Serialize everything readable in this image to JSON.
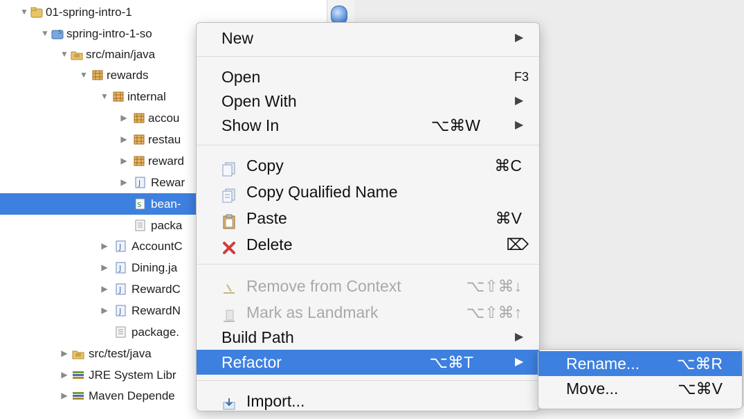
{
  "tree": {
    "rows": [
      {
        "label": "01-spring-intro-1",
        "icon": "project-icon"
      },
      {
        "label": "spring-intro-1-so",
        "icon": "spring-project-icon"
      },
      {
        "label": "src/main/java",
        "icon": "source-folder-icon"
      },
      {
        "label": "rewards",
        "icon": "package-icon"
      },
      {
        "label": "internal",
        "icon": "package-icon"
      },
      {
        "label": "accou",
        "icon": "package-icon"
      },
      {
        "label": "restau",
        "icon": "package-icon"
      },
      {
        "label": "reward",
        "icon": "package-icon"
      },
      {
        "label": "Rewar",
        "icon": "java-file-icon"
      },
      {
        "label": "bean-",
        "icon": "spring-bean-file-icon"
      },
      {
        "label": "packa",
        "icon": "text-file-icon"
      },
      {
        "label": "AccountC",
        "icon": "java-file-icon"
      },
      {
        "label": "Dining.ja",
        "icon": "java-file-icon"
      },
      {
        "label": "RewardC",
        "icon": "java-file-icon"
      },
      {
        "label": "RewardN",
        "icon": "java-file-icon"
      },
      {
        "label": "package.",
        "icon": "text-file-icon"
      },
      {
        "label": "src/test/java",
        "icon": "source-folder-icon"
      },
      {
        "label": "JRE System Libr",
        "icon": "library-icon"
      },
      {
        "label": "Maven Depende",
        "icon": "library-icon"
      }
    ]
  },
  "context_menu": {
    "items": [
      {
        "label": "New",
        "shortcut": "",
        "submenu": true
      },
      {
        "label": "Open",
        "shortcut": "F3"
      },
      {
        "label": "Open With",
        "shortcut": "",
        "submenu": true
      },
      {
        "label": "Show In",
        "shortcut": "⌥⌘W",
        "submenu": true
      },
      {
        "label": "Copy",
        "shortcut": "⌘C",
        "icon": "copy-icon"
      },
      {
        "label": "Copy Qualified Name",
        "shortcut": "",
        "icon": "copy-qualified-name-icon"
      },
      {
        "label": "Paste",
        "shortcut": "⌘V",
        "icon": "paste-icon"
      },
      {
        "label": "Delete",
        "shortcut": "⌦",
        "icon": "delete-icon"
      },
      {
        "label": "Remove from Context",
        "shortcut": "⌥⇧⌘↓",
        "icon": "remove-context-icon",
        "disabled": true
      },
      {
        "label": "Mark as Landmark",
        "shortcut": "⌥⇧⌘↑",
        "icon": "landmark-icon",
        "disabled": true
      },
      {
        "label": "Build Path",
        "shortcut": "",
        "submenu": true
      },
      {
        "label": "Refactor",
        "shortcut": "⌥⌘T",
        "submenu": true,
        "active": true
      },
      {
        "label": "Import...",
        "shortcut": "",
        "icon": "import-icon"
      }
    ]
  },
  "refactor_submenu": {
    "items": [
      {
        "label": "Rename...",
        "shortcut": "⌥⌘R",
        "active": true
      },
      {
        "label": "Move...",
        "shortcut": "⌥⌘V"
      }
    ]
  },
  "colors": {
    "selection": "#3d80df",
    "menu_background": "#f5f5f5",
    "disabled_text": "#a9a9a9"
  }
}
